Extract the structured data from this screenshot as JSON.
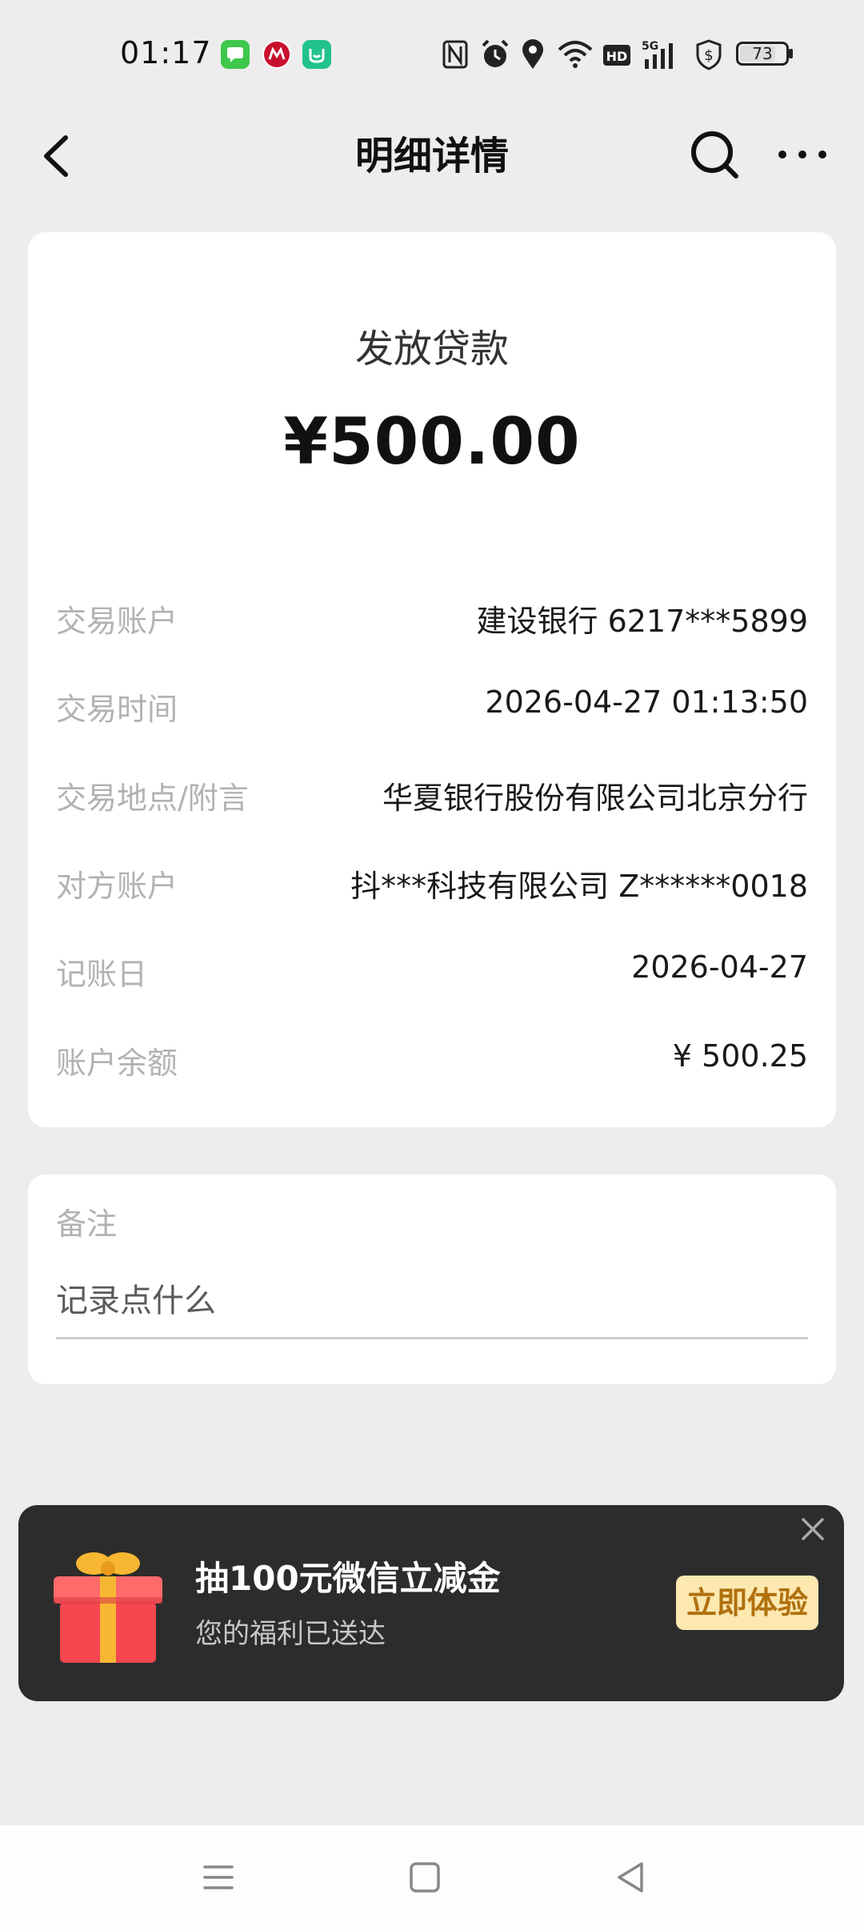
{
  "status_bar": {
    "time": "01:17",
    "app_icons": [
      "messages-icon",
      "cmb-icon",
      "mi-home-icon"
    ],
    "system_icons": [
      "nfc-icon",
      "alarm-icon",
      "location-icon",
      "wifi-icon",
      "hd-icon",
      "signal-5g-icon",
      "shield-dollar-icon",
      "battery-icon"
    ],
    "battery": "73"
  },
  "header": {
    "title": "明细详情"
  },
  "transaction": {
    "type": "发放贷款",
    "amount": "¥500.00",
    "rows": [
      {
        "label": "交易账户",
        "value": "建设银行 6217***5899"
      },
      {
        "label": "交易时间",
        "value": "2026-04-27 01:13:50"
      },
      {
        "label": "交易地点/附言",
        "value": "华夏银行股份有限公司北京分行"
      },
      {
        "label": "对方账户",
        "value": "抖***科技有限公司 Z******0018"
      },
      {
        "label": "记账日",
        "value": "2026-04-27"
      },
      {
        "label": "账户余额",
        "value": "¥ 500.25"
      }
    ]
  },
  "note": {
    "label": "备注",
    "placeholder": "记录点什么"
  },
  "promo": {
    "title": "抽100元微信立减金",
    "subtitle": "您的福利已送达",
    "button": "立即体验"
  },
  "colors": {
    "background": "#ededed",
    "card": "#ffffff",
    "label_gray": "#b2b2b2",
    "promo_bg": "#2c2c2c",
    "promo_button_bg": "#fde8b0",
    "promo_button_text": "#b0700e"
  }
}
